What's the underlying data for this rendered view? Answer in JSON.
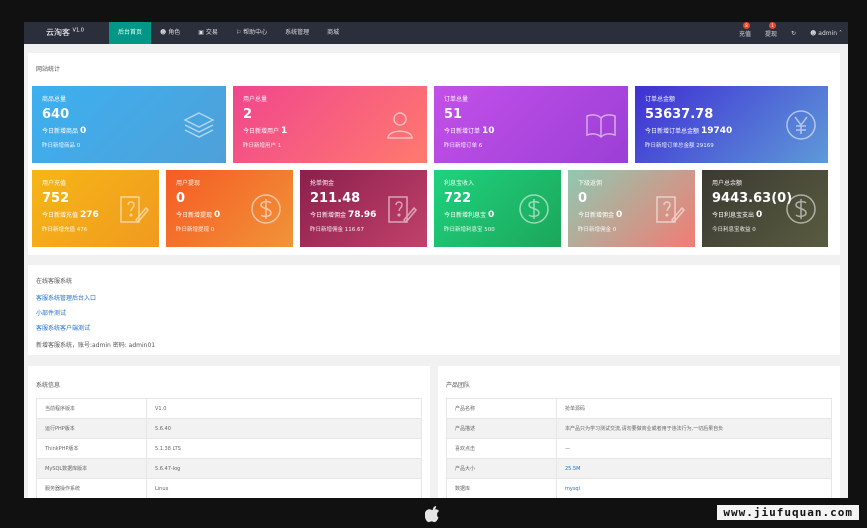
{
  "app": {
    "name": "云淘客",
    "version": "V1.0"
  },
  "nav": [
    "后台首页",
    "角色",
    "交易",
    "帮助中心",
    "系统管理",
    "商城"
  ],
  "right_nav": {
    "recharge": {
      "label": "充值",
      "badge": "8"
    },
    "withdraw": {
      "label": "提现",
      "badge": "1"
    },
    "user": "admin"
  },
  "stats_title": "网站统计",
  "row1": [
    {
      "title": "商品总量",
      "value": "640",
      "line1_label": "今日新增商品",
      "line1_value": "0",
      "line2": "昨日新增商品 0",
      "icon": "layers-icon",
      "grad": "linear-gradient(135deg,#3cb0f0,#4fa0d8)"
    },
    {
      "title": "用户总量",
      "value": "2",
      "line1_label": "今日新增用户",
      "line1_value": "1",
      "line2": "昨日新增用户 1",
      "icon": "users-icon",
      "grad": "linear-gradient(135deg,#f0468e,#ff7a6e)"
    },
    {
      "title": "订单总量",
      "value": "51",
      "line1_label": "今日新增订单",
      "line1_value": "10",
      "line2": "昨日新增订单 6",
      "icon": "book-icon",
      "grad": "linear-gradient(135deg,#c350e8,#9b3fd6)"
    },
    {
      "title": "订单总金额",
      "value": "53637.78",
      "line1_label": "今日新增订单总金额",
      "line1_value": "19740",
      "line2": "昨日新增订单总金额 29169",
      "icon": "yen-icon",
      "grad": "linear-gradient(135deg,#3f2fd4,#5e9ad8)"
    }
  ],
  "row2": [
    {
      "title": "用户充值",
      "value": "752",
      "line1_label": "今日新增充值",
      "line1_value": "276",
      "line2": "昨日新增充值 476",
      "icon": "edit-icon",
      "grad": "linear-gradient(135deg,#f6b616,#f09a20)"
    },
    {
      "title": "用户提现",
      "value": "0",
      "line1_label": "今日新增提现",
      "line1_value": "0",
      "line2": "昨日新增提现 0",
      "icon": "dollar-icon",
      "grad": "linear-gradient(135deg,#f65b24,#f09438)"
    },
    {
      "title": "抢单佣金",
      "value": "211.48",
      "line1_label": "今日新增佣金",
      "line1_value": "78.96",
      "line2": "昨日新增佣金 116.67",
      "icon": "edit-icon",
      "grad": "linear-gradient(135deg,#8c1f4c,#c0426a)"
    },
    {
      "title": "利息宝收入",
      "value": "722",
      "line1_label": "今日新增利息宝",
      "line1_value": "0",
      "line2": "昨日新增利息宝 500",
      "icon": "dollar-icon",
      "grad": "linear-gradient(135deg,#1fd27e,#1ca65a)"
    },
    {
      "title": "下级返佣",
      "value": "0",
      "line1_label": "今日新增佣金",
      "line1_value": "0",
      "line2": "昨日新增佣金 0",
      "icon": "edit-icon",
      "grad": "linear-gradient(135deg,#8fc9b0,#f27c74)"
    },
    {
      "title": "用户总余额",
      "value": "9443.63(0)",
      "line1_label": "今日利息宝支出",
      "line1_value": "0",
      "line2": "今日利息宝收益 0",
      "icon": "dollar-icon",
      "grad": "linear-gradient(135deg,#3a3a32,#595c40)"
    }
  ],
  "service": {
    "title": "在线客服系统",
    "links": [
      "客服系统管理后台入口",
      "小部件测试",
      "客服系统客户端测试"
    ],
    "note": "新增客服系统，账号:admin 密码: admin01"
  },
  "sysinfo": {
    "title": "系统信息",
    "rows": [
      [
        "当前程序版本",
        "V1.0"
      ],
      [
        "运行PHP版本",
        "5.6.40"
      ],
      [
        "ThinkPHP版本",
        "5.1.38 LTS"
      ],
      [
        "MySQL数据库版本",
        "5.6.47-log"
      ],
      [
        "服务器操作系统",
        "Linux"
      ]
    ]
  },
  "product": {
    "title": "产品团队",
    "rows": [
      [
        "产品名称",
        "抢单源码"
      ],
      [
        "产品描述",
        "本产品只为学习测试交流,请勿要做商业或者用于违法行为,一切后果自负"
      ],
      [
        "喜欢点击",
        "—"
      ],
      [
        "产品大小",
        "25.5M"
      ],
      [
        "数据库",
        "mysql"
      ]
    ]
  },
  "watermark": "www.jiufuquan.com",
  "colors": {
    "topbar": "#2b2f3b",
    "active_nav": "#009688",
    "link": "#1e6fd0"
  }
}
